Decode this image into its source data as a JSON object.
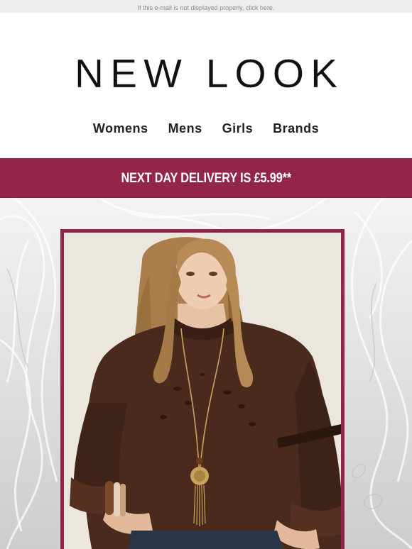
{
  "preheader": {
    "text": "If this e-mail is not displayed properly, click here."
  },
  "brand": {
    "name": "NEW LOOK",
    "accent_color": "#93244a"
  },
  "nav": {
    "items": [
      {
        "label": "Womens"
      },
      {
        "label": "Mens"
      },
      {
        "label": "Girls"
      },
      {
        "label": "Brands"
      }
    ]
  },
  "banner": {
    "text": "NEXT DAY DELIVERY IS £5.99**"
  },
  "hero": {
    "image": "model-brown-blouse-photo"
  }
}
